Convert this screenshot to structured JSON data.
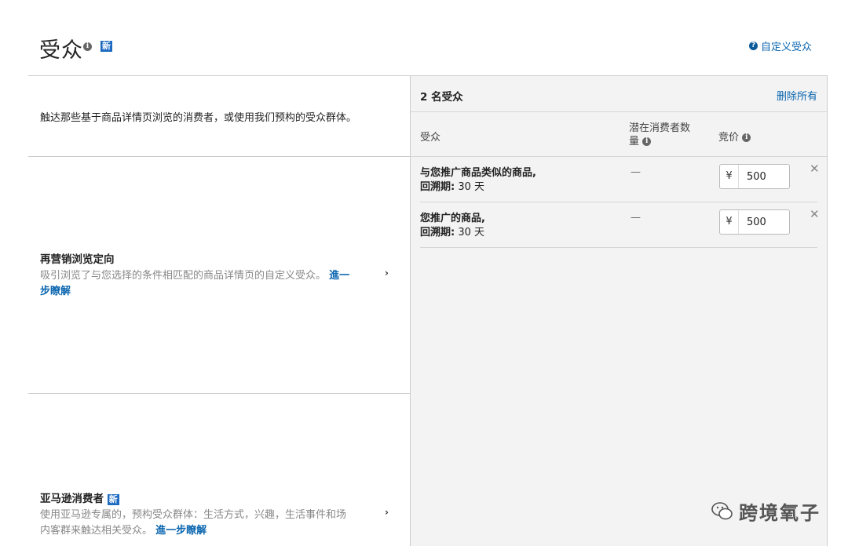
{
  "header": {
    "title": "受众",
    "new_badge": "新",
    "custom_audience_link": "自定义受众"
  },
  "left": {
    "intro": "触达那些基于商品详情页浏览的消费者，或使用我们预构的受众群体。",
    "remarketing": {
      "title": "再营销浏览定向",
      "desc": "吸引浏览了与您选择的条件相匹配的商品详情页的自定义受众。",
      "learn_more_part1": "進一",
      "learn_more_part2": "步瞭解"
    },
    "amazon": {
      "title": "亚马逊消费者",
      "new_badge": "新",
      "desc_line1": "使用亚马逊专属的，预构受众群体：生活方式，兴趣，生活事件和场",
      "desc_line2": "内客群来触达相关受众。",
      "learn_more": "進一步瞭解"
    }
  },
  "right": {
    "count_label": "2 名受众",
    "remove_all": "删除所有",
    "columns": {
      "audience": "受众",
      "reach_line1": "潜在消费者数",
      "reach_line2": "量",
      "bid": "竞价"
    },
    "rows": [
      {
        "name": "与您推广商品类似的商品,",
        "lookback_label": "回溯期:",
        "lookback_value": "30 天",
        "reach": "—",
        "currency": "¥",
        "bid": "500"
      },
      {
        "name": "您推广的商品,",
        "lookback_label": "回溯期:",
        "lookback_value": "30 天",
        "reach": "—",
        "currency": "¥",
        "bid": "500"
      }
    ]
  },
  "watermark": "跨境氧子",
  "icons": {
    "info": "info-icon",
    "help": "help-icon",
    "chevron": "chevron-right-icon",
    "remove": "close-icon",
    "watermark": "wechat-icon"
  },
  "colors": {
    "link": "#0b66b0",
    "badge": "#1b6ac1",
    "panel_bg": "#f3f3f3"
  }
}
